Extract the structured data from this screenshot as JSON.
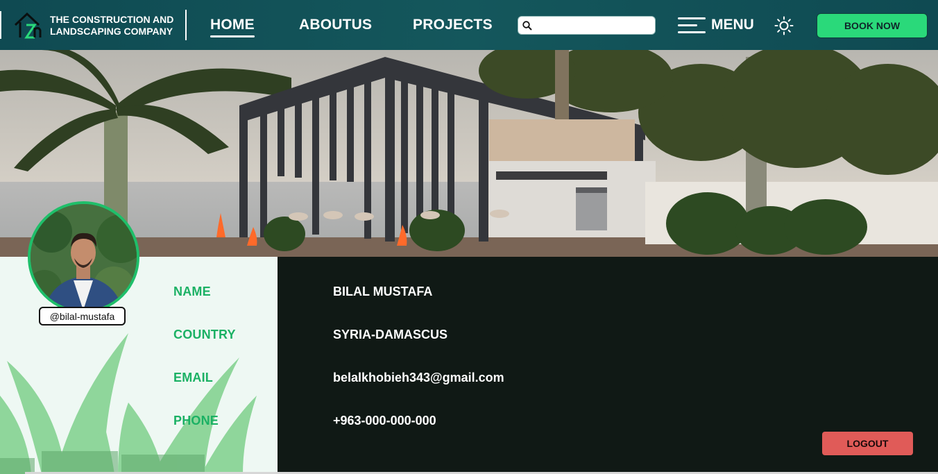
{
  "brand": {
    "line1": "THE CONSTRUCTION AND",
    "line2": "LANDSCAPING COMPANY",
    "logo_icon": "house-logo-icon"
  },
  "nav": {
    "links": [
      {
        "label": "HOME",
        "active": true
      },
      {
        "label": "ABOUTUS",
        "active": false
      },
      {
        "label": "PROJECTS",
        "active": false
      }
    ],
    "search_placeholder": "",
    "menu_label": "MENU",
    "book_label": "BOOK NOW"
  },
  "profile": {
    "handle": "@bilal-mustafa",
    "fields": [
      {
        "label": "NAME",
        "value": "BILAL MUSTAFA"
      },
      {
        "label": "COUNTRY",
        "value": "SYRIA-DAMASCUS"
      },
      {
        "label": "EMAIL",
        "value": "belalkhobieh343@gmail.com"
      },
      {
        "label": "PHONE",
        "value": "+963-000-000-000"
      }
    ],
    "logout_label": "LOGOUT"
  },
  "colors": {
    "nav_bg": "#14575c",
    "accent_green": "#2ad97a",
    "label_green": "#1bb164",
    "panel_dark": "#101915",
    "logout_red": "#e05b58"
  }
}
